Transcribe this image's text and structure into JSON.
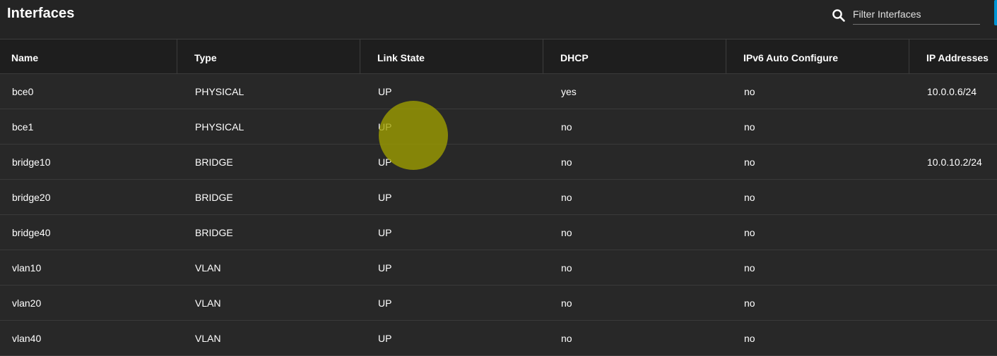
{
  "header": {
    "title": "Interfaces",
    "search_placeholder": "Filter Interfaces",
    "search_icon": "search-icon"
  },
  "columns": [
    "Name",
    "Type",
    "Link State",
    "DHCP",
    "IPv6 Auto Configure",
    "IP Addresses"
  ],
  "rows": [
    [
      "bce0",
      "PHYSICAL",
      "UP",
      "yes",
      "no",
      "10.0.0.6/24"
    ],
    [
      "bce1",
      "PHYSICAL",
      "UP",
      "no",
      "no",
      ""
    ],
    [
      "bridge10",
      "BRIDGE",
      "UP",
      "no",
      "no",
      "10.0.10.2/24"
    ],
    [
      "bridge20",
      "BRIDGE",
      "UP",
      "no",
      "no",
      ""
    ],
    [
      "bridge40",
      "BRIDGE",
      "UP",
      "no",
      "no",
      ""
    ],
    [
      "vlan10",
      "VLAN",
      "UP",
      "no",
      "no",
      ""
    ],
    [
      "vlan20",
      "VLAN",
      "UP",
      "no",
      "no",
      ""
    ],
    [
      "vlan40",
      "VLAN",
      "UP",
      "no",
      "no",
      ""
    ]
  ],
  "colors": {
    "background": "#282828",
    "header_row": "#1e1e1e",
    "accent": "#0095d5",
    "cursor_highlight": "#a0a000"
  }
}
